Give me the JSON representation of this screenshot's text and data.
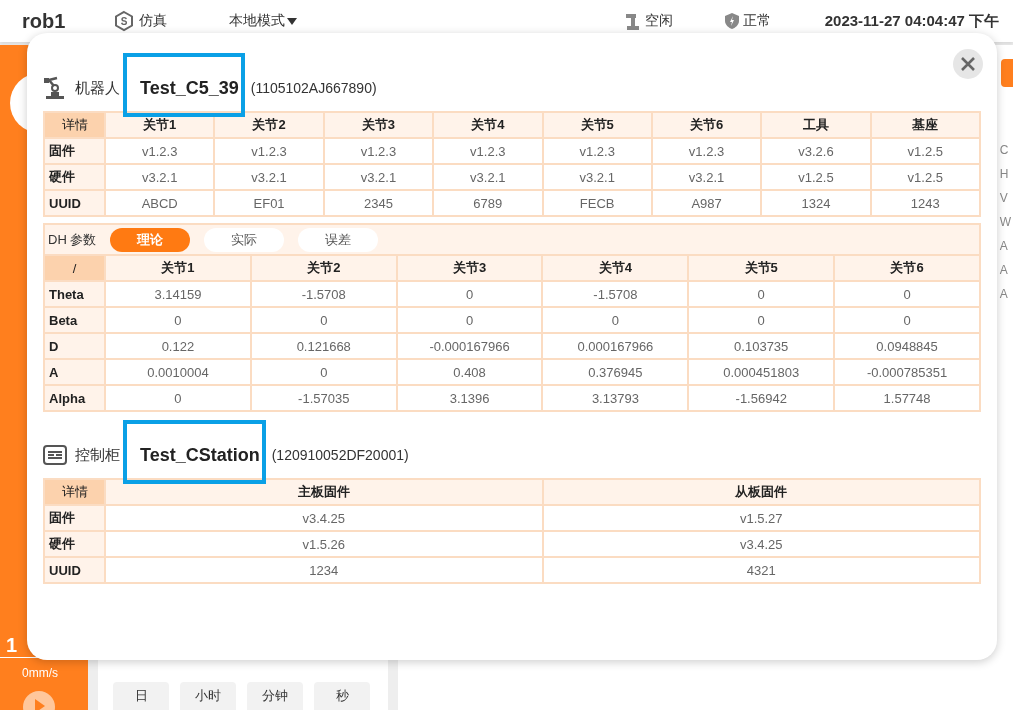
{
  "header": {
    "title": "rob1",
    "sim_icon_letter": "S",
    "sim_label": "仿真",
    "mode": "本地模式",
    "status_idle": "空闲",
    "status_safety": "正常",
    "datetime": "2023-11-27 04:04:47 下午"
  },
  "background": {
    "speed_value": "1",
    "speed_unit": "0mm/s",
    "time_buttons": [
      "日",
      "小时",
      "分钟",
      "秒"
    ],
    "right_letters": [
      "C",
      "H",
      "V",
      "W",
      "A",
      "A",
      "A"
    ]
  },
  "dialog": {
    "robot": {
      "label": "机器人",
      "name": "Test_C5_39",
      "serial": "(1105102AJ667890)",
      "highlighted": true,
      "table": {
        "corner": "详情",
        "columns": [
          "关节1",
          "关节2",
          "关节3",
          "关节4",
          "关节5",
          "关节6",
          "工具",
          "基座"
        ],
        "rows": [
          {
            "label": "固件",
            "cells": [
              "v1.2.3",
              "v1.2.3",
              "v1.2.3",
              "v1.2.3",
              "v1.2.3",
              "v1.2.3",
              "v3.2.6",
              "v1.2.5"
            ]
          },
          {
            "label": "硬件",
            "cells": [
              "v3.2.1",
              "v3.2.1",
              "v3.2.1",
              "v3.2.1",
              "v3.2.1",
              "v3.2.1",
              "v1.2.5",
              "v1.2.5"
            ]
          },
          {
            "label": "UUID",
            "cells": [
              "ABCD",
              "EF01",
              "2345",
              "6789",
              "FECB",
              "A987",
              "1324",
              "1243"
            ]
          }
        ]
      }
    },
    "dh": {
      "label": "DH 参数",
      "tabs": [
        {
          "label": "理论",
          "selected": true
        },
        {
          "label": "实际",
          "selected": false
        },
        {
          "label": "误差",
          "selected": false
        }
      ],
      "table": {
        "corner": "/",
        "columns": [
          "关节1",
          "关节2",
          "关节3",
          "关节4",
          "关节5",
          "关节6"
        ],
        "rows": [
          {
            "label": "Theta",
            "cells": [
              "3.14159",
              "-1.5708",
              "0",
              "-1.5708",
              "0",
              "0"
            ]
          },
          {
            "label": "Beta",
            "cells": [
              "0",
              "0",
              "0",
              "0",
              "0",
              "0"
            ]
          },
          {
            "label": "D",
            "cells": [
              "0.122",
              "0.121668",
              "-0.000167966",
              "0.000167966",
              "0.103735",
              "0.0948845"
            ]
          },
          {
            "label": "A",
            "cells": [
              "0.0010004",
              "0",
              "0.408",
              "0.376945",
              "0.000451803",
              "-0.000785351"
            ]
          },
          {
            "label": "Alpha",
            "cells": [
              "0",
              "-1.57035",
              "3.1396",
              "3.13793",
              "-1.56942",
              "1.57748"
            ]
          }
        ]
      }
    },
    "controller": {
      "label": "控制柜",
      "name": "Test_CStation",
      "serial": "(120910052DF20001)",
      "highlighted": true,
      "table": {
        "corner": "详情",
        "columns": [
          "主板固件",
          "从板固件"
        ],
        "rows": [
          {
            "label": "固件",
            "cells": [
              "v3.4.25",
              "v1.5.27"
            ]
          },
          {
            "label": "硬件",
            "cells": [
              "v1.5.26",
              "v3.4.25"
            ]
          },
          {
            "label": "UUID",
            "cells": [
              "1234",
              "4321"
            ]
          }
        ]
      }
    }
  }
}
